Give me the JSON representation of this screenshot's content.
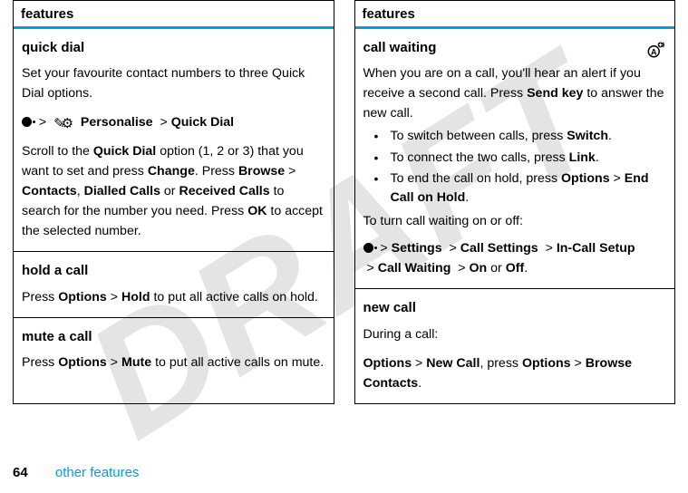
{
  "watermark": "DRAFT",
  "header": "features",
  "left": {
    "quick_dial": {
      "title": "quick dial",
      "intro": "Set your favourite contact numbers to three Quick Dial options.",
      "gt": ">",
      "pers": "Personalise",
      "qd": "Quick Dial",
      "p2a": "Scroll to the ",
      "p2b": "Quick Dial",
      "p2c": " option (1, 2 or 3) that you want to set and press ",
      "p2d": "Change",
      "p2e": ". Press ",
      "p2f": "Browse",
      "p2g": "Contacts",
      "p2h": ", ",
      "p2i": "Dialled Calls",
      "p2j": " or ",
      "p2k": "Received Calls",
      "p2l": " to search for the number you need. Press ",
      "p2m": "OK",
      "p2n": " to accept the selected number."
    },
    "hold": {
      "title": "hold a call",
      "a": "Press ",
      "b": "Options",
      "c": "Hold",
      "d": " to put all active calls on hold."
    },
    "mute": {
      "title": "mute a call",
      "a": "Press ",
      "b": "Options",
      "c": "Mute",
      "d": " to put all active calls on mute."
    }
  },
  "right": {
    "cw": {
      "title": "call waiting",
      "p1a": "When you are on a call, you'll hear an alert if you receive a second call. Press ",
      "p1b": "Send key",
      "p1c": " to answer the new call.",
      "li1a": "To switch between calls, press ",
      "li1b": "Switch",
      "li2a": "To connect the two calls, press ",
      "li2b": "Link",
      "li3a": "To end the call on hold, press ",
      "li3b": "Options",
      "li3c": "End Call on Hold",
      "p2": "To turn call waiting on or off:",
      "s": "Settings",
      "cs": "Call Settings",
      "ics": "In-Call Setup",
      "cwl": "Call Waiting",
      "on": "On",
      "or": " or ",
      "off": "Off",
      "dot": "."
    },
    "nc": {
      "title": "new call",
      "p1": "During a call:",
      "opt": "Options",
      "ncall": "New Call",
      "mid": ", press ",
      "opt2": "Options",
      "bc": "Browse Contacts"
    }
  },
  "footer": {
    "page": "64",
    "label": "other features"
  },
  "gt": ">"
}
